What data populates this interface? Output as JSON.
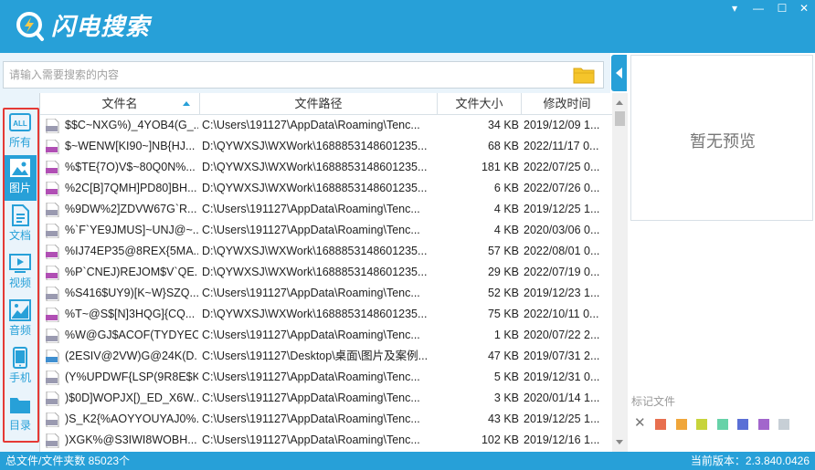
{
  "app": {
    "title": "闪电搜索",
    "window_controls": [
      "▾",
      "—",
      "☐",
      "✕"
    ]
  },
  "search": {
    "placeholder": "请输入需要搜索的内容",
    "value": ""
  },
  "sidebar": {
    "items": [
      {
        "label": "所有",
        "icon": "all-icon",
        "active": false
      },
      {
        "label": "图片",
        "icon": "image-icon",
        "active": true
      },
      {
        "label": "文档",
        "icon": "document-icon",
        "active": false
      },
      {
        "label": "视频",
        "icon": "video-icon",
        "active": false
      },
      {
        "label": "音频",
        "icon": "audio-icon",
        "active": false
      },
      {
        "label": "手机",
        "icon": "phone-icon",
        "active": false
      },
      {
        "label": "目录",
        "icon": "folder-icon",
        "active": false
      }
    ],
    "all_icon_text": "ALL"
  },
  "table": {
    "columns": [
      "文件名",
      "文件路径",
      "文件大小",
      "修改时间"
    ],
    "sort_column": "文件名",
    "rows": [
      {
        "type": "bmp",
        "name": "$$C~NXG%)_4YOB4(G_...",
        "path": "C:\\Users\\191127\\AppData\\Roaming\\Tenc...",
        "size": "34 KB",
        "modified": "2019/12/09 1..."
      },
      {
        "type": "png",
        "name": "$~WENW[KI90~]NB{HJ...",
        "path": "D:\\QYWXSJ\\WXWork\\1688853148601235...",
        "size": "68 KB",
        "modified": "2022/11/17 0..."
      },
      {
        "type": "png",
        "name": "%$TE{7O)V$~80Q0N%...",
        "path": "D:\\QYWXSJ\\WXWork\\1688853148601235...",
        "size": "181 KB",
        "modified": "2022/07/25 0..."
      },
      {
        "type": "png",
        "name": "%2C[B]7QMH]PD80]BH...",
        "path": "D:\\QYWXSJ\\WXWork\\1688853148601235...",
        "size": "6 KB",
        "modified": "2022/07/26 0..."
      },
      {
        "type": "bmp",
        "name": "%9DW%2]ZDVW67G`R...",
        "path": "C:\\Users\\191127\\AppData\\Roaming\\Tenc...",
        "size": "4 KB",
        "modified": "2019/12/25 1..."
      },
      {
        "type": "bmp",
        "name": "%`F`YE9JMUS]~UNJ@~...",
        "path": "C:\\Users\\191127\\AppData\\Roaming\\Tenc...",
        "size": "4 KB",
        "modified": "2020/03/06 0..."
      },
      {
        "type": "png",
        "name": "%IJ74EP35@8REX{5MA...",
        "path": "D:\\QYWXSJ\\WXWork\\1688853148601235...",
        "size": "57 KB",
        "modified": "2022/08/01 0..."
      },
      {
        "type": "png",
        "name": "%P`CNEJ)REJOM$V`QE...",
        "path": "D:\\QYWXSJ\\WXWork\\1688853148601235...",
        "size": "29 KB",
        "modified": "2022/07/19 0..."
      },
      {
        "type": "bmp",
        "name": "%S416$UY9)[K~W}SZQ...",
        "path": "C:\\Users\\191127\\AppData\\Roaming\\Tenc...",
        "size": "52 KB",
        "modified": "2019/12/23 1..."
      },
      {
        "type": "png",
        "name": "%T~@S$[N]3HQG]{CQ...",
        "path": "D:\\QYWXSJ\\WXWork\\1688853148601235...",
        "size": "75 KB",
        "modified": "2022/10/11 0..."
      },
      {
        "type": "bmp",
        "name": "%W@GJ$ACOF(TYDYEC...",
        "path": "C:\\Users\\191127\\AppData\\Roaming\\Tenc...",
        "size": "1 KB",
        "modified": "2020/07/22 2..."
      },
      {
        "type": "jpg",
        "name": "(2ESIV@2VW)G@24K(D...",
        "path": "C:\\Users\\191127\\Desktop\\桌面\\图片及案例...",
        "size": "47 KB",
        "modified": "2019/07/31 2..."
      },
      {
        "type": "bmp",
        "name": "(Y%UPDWF{LSP(9R8E$K...",
        "path": "C:\\Users\\191127\\AppData\\Roaming\\Tenc...",
        "size": "5 KB",
        "modified": "2019/12/31 0..."
      },
      {
        "type": "bmp",
        "name": ")$0D]WOPJX[)_ED_X6W...",
        "path": "C:\\Users\\191127\\AppData\\Roaming\\Tenc...",
        "size": "3 KB",
        "modified": "2020/01/14 1..."
      },
      {
        "type": "bmp",
        "name": ")S_K2{%AOYYOUYAJ0%...",
        "path": "C:\\Users\\191127\\AppData\\Roaming\\Tenc...",
        "size": "43 KB",
        "modified": "2019/12/25 1..."
      },
      {
        "type": "bmp",
        "name": ")XGK%@S3IWI8WOBH...",
        "path": "C:\\Users\\191127\\AppData\\Roaming\\Tenc...",
        "size": "102 KB",
        "modified": "2019/12/16 1..."
      }
    ]
  },
  "preview": {
    "empty_text": "暂无预览"
  },
  "marks": {
    "label": "标记文件",
    "colors": [
      "#e86f4f",
      "#f0a63a",
      "#c7d43b",
      "#67d2a8",
      "#5a6fd6",
      "#a266cc",
      "#c7cfd6"
    ]
  },
  "status": {
    "left": "总文件/文件夹数 85023个",
    "right": "当前版本：2.3.840.0426"
  },
  "theme": {
    "accent": "#27a0d8",
    "highlight": "#e53935"
  }
}
